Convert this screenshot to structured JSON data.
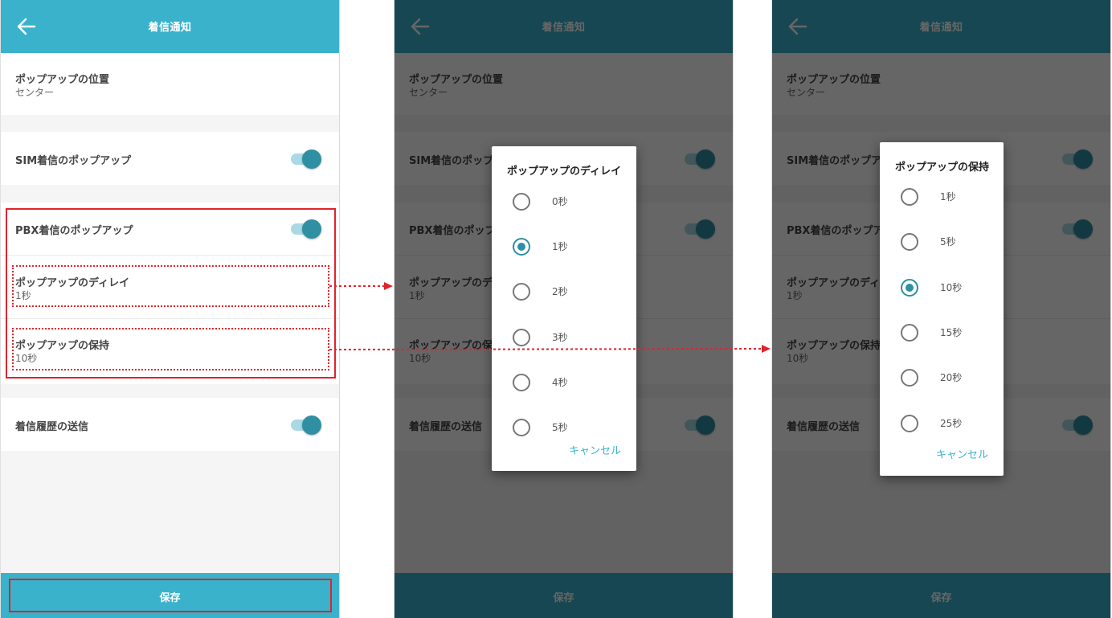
{
  "screen": {
    "title": "着信通知",
    "popup_position": {
      "label": "ポップアップの位置",
      "value": "センター"
    },
    "sim_popup": {
      "label": "SIM着信のポップアップ",
      "on": true
    },
    "pbx_popup": {
      "label": "PBX着信のポップアップ",
      "on": true
    },
    "popup_delay": {
      "label": "ポップアップのディレイ",
      "value": "1秒"
    },
    "popup_hold": {
      "label": "ポップアップの保持",
      "value": "10秒"
    },
    "send_history": {
      "label": "着信履歴の送信",
      "on": true
    },
    "save_label": "保存"
  },
  "delay_dialog": {
    "title": "ポップアップのディレイ",
    "options": [
      "0秒",
      "1秒",
      "2秒",
      "3秒",
      "4秒",
      "5秒"
    ],
    "selected": "1秒",
    "cancel": "キャンセル"
  },
  "hold_dialog": {
    "title": "ポップアップの保持",
    "options": [
      "1秒",
      "5秒",
      "10秒",
      "15秒",
      "20秒",
      "25秒"
    ],
    "selected": "10秒",
    "cancel": "キャンセル"
  },
  "colors": {
    "primary": "#3ab2cc",
    "toggle_on": "#2f8fa3",
    "annotation": "#e0242c"
  },
  "icons": {
    "back": "arrow-left-icon"
  }
}
